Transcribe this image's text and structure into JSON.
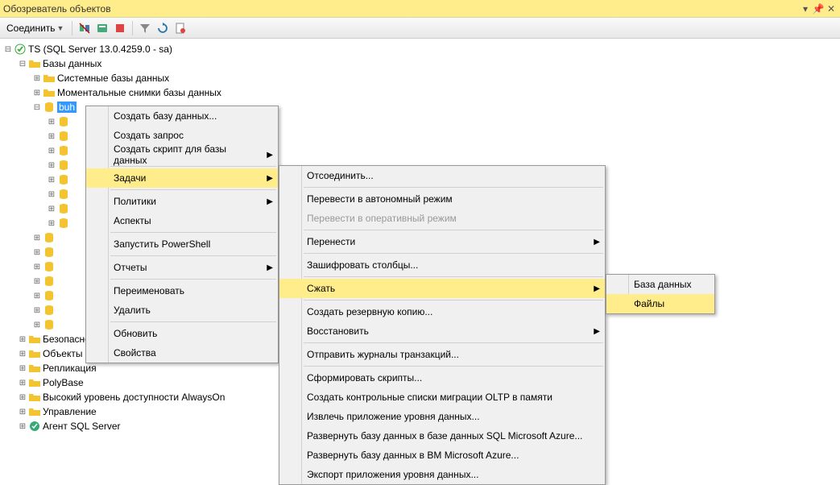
{
  "title_bar": {
    "title": "Обозреватель объектов"
  },
  "toolbar": {
    "connect_label": "Соединить"
  },
  "tree": {
    "root": "TS (SQL Server 13.0.4259.0 - sa)",
    "databases": "Базы данных",
    "sys_db": "Системные базы данных",
    "snapshots": "Моментальные снимки базы данных",
    "buh": "buh",
    "security": "Безопасность",
    "server_objects": "Объекты сервера",
    "replication": "Репликация",
    "polybase": "PolyBase",
    "alwayson": "Высокий уровень доступности AlwaysOn",
    "management": "Управление",
    "agent": "Агент SQL Server"
  },
  "menu1": {
    "create_db": "Создать базу данных...",
    "create_query": "Создать запрос",
    "create_script": "Создать скрипт для базы данных",
    "tasks": "Задачи",
    "policies": "Политики",
    "aspects": "Аспекты",
    "powershell": "Запустить PowerShell",
    "reports": "Отчеты",
    "rename": "Переименовать",
    "delete": "Удалить",
    "refresh": "Обновить",
    "properties": "Свойства"
  },
  "menu2": {
    "detach": "Отсоединить...",
    "offline": "Перевести в автономный режим",
    "online": "Перевести в оперативный режим",
    "move": "Перенести",
    "encrypt": "Зашифровать столбцы...",
    "shrink": "Сжать",
    "backup": "Создать резервную копию...",
    "restore": "Восстановить",
    "ship_logs": "Отправить журналы транзакций...",
    "gen_scripts": "Сформировать скрипты...",
    "oltp": "Создать контрольные списки миграции OLTP в памяти",
    "extract_app": "Извлечь приложение уровня данных...",
    "deploy_azure_db": "Развернуть базу данных в базе данных SQL Microsoft Azure...",
    "deploy_azure_vm": "Развернуть базу данных в ВМ Microsoft Azure...",
    "export_app": "Экспорт приложения уровня данных..."
  },
  "menu3": {
    "database": "База данных",
    "files": "Файлы"
  }
}
